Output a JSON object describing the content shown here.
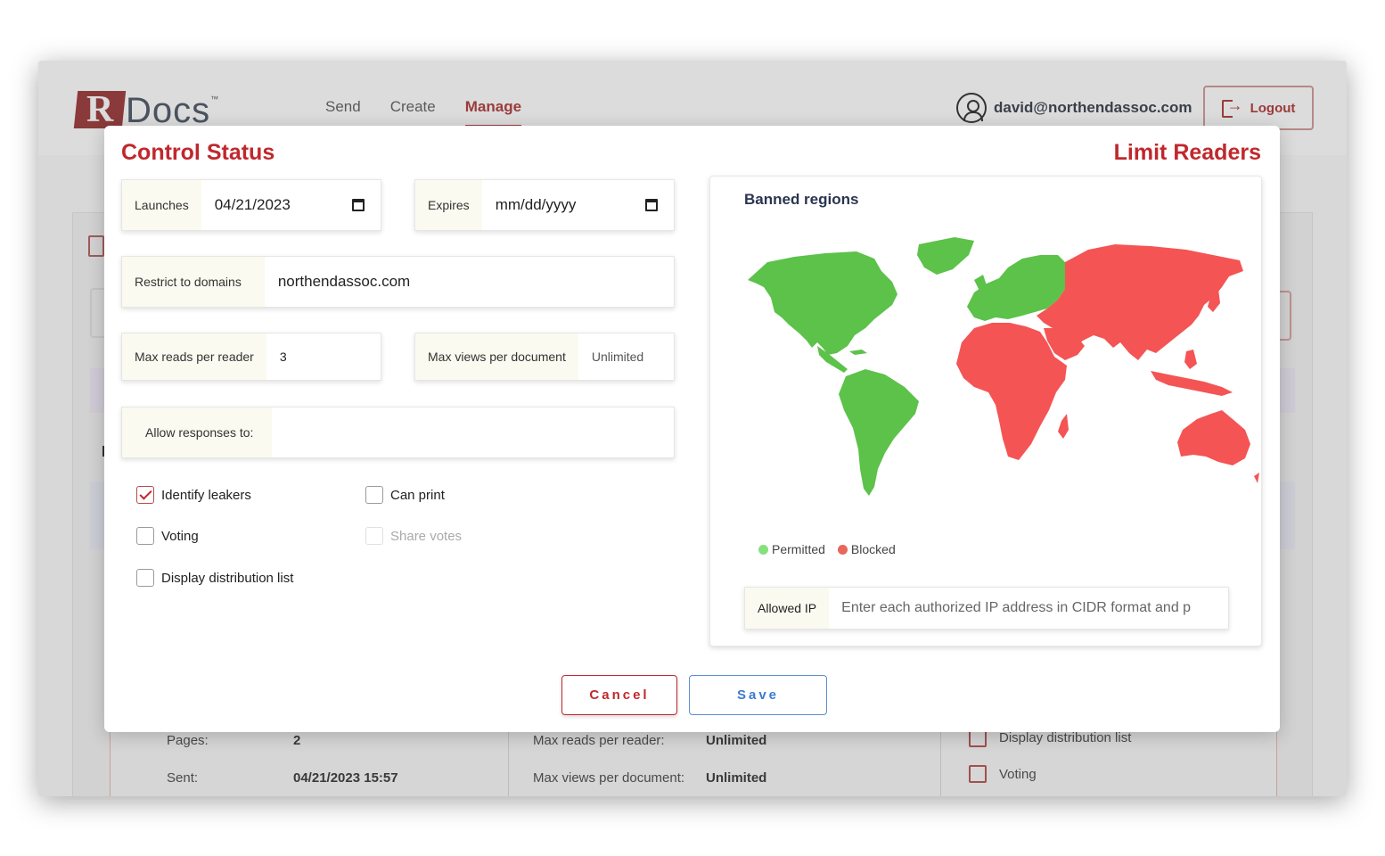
{
  "app": {
    "logo_initial": "R",
    "logo_text": "Docs",
    "logo_tm": "™"
  },
  "nav": {
    "items": [
      "Send",
      "Create",
      "Manage"
    ],
    "active": "Manage"
  },
  "user": {
    "email": "david@northendassoc.com",
    "logout_label": "Logout"
  },
  "background_details": {
    "pages_label": "Pages:",
    "pages_value": "2",
    "sent_label": "Sent:",
    "sent_value": "04/21/2023 15:57",
    "max_reads_label": "Max reads per reader:",
    "max_reads_value": "Unlimited",
    "max_views_label": "Max views per document:",
    "max_views_value": "Unlimited",
    "option_1": "Display distribution list",
    "option_2": "Voting"
  },
  "modal": {
    "left_title": "Control Status",
    "right_title": "Limit Readers",
    "launches_label": "Launches",
    "launches_value": "04/21/2023",
    "expires_label": "Expires",
    "expires_placeholder": "mm/dd/yyyy",
    "domains_label": "Restrict to domains",
    "domains_value": "northendassoc.com",
    "max_reads_label": "Max reads per reader",
    "max_reads_value": "3",
    "max_views_label": "Max views per document",
    "max_views_value": "Unlimited",
    "responses_label": "Allow responses to:",
    "responses_value": "",
    "checkboxes": {
      "identify_leakers": {
        "label": "Identify leakers",
        "checked": true
      },
      "can_print": {
        "label": "Can print",
        "checked": false
      },
      "voting": {
        "label": "Voting",
        "checked": false
      },
      "share_votes": {
        "label": "Share votes",
        "checked": false,
        "disabled": true
      },
      "display_distribution": {
        "label": "Display distribution list",
        "checked": false
      }
    },
    "map": {
      "title": "Banned regions",
      "legend_permitted": "Permitted",
      "legend_blocked": "Blocked",
      "permitted_color": "#5cc24a",
      "blocked_color": "#f45454",
      "permitted_regions": [
        "North America",
        "South America",
        "Greenland",
        "Europe"
      ],
      "blocked_regions": [
        "Africa",
        "Middle East",
        "Asia",
        "Australia"
      ]
    },
    "allowed_ip_label": "Allowed IP",
    "allowed_ip_placeholder": "Enter each authorized IP address in CIDR format and p",
    "cancel_label": "Cancel",
    "save_label": "Save"
  }
}
